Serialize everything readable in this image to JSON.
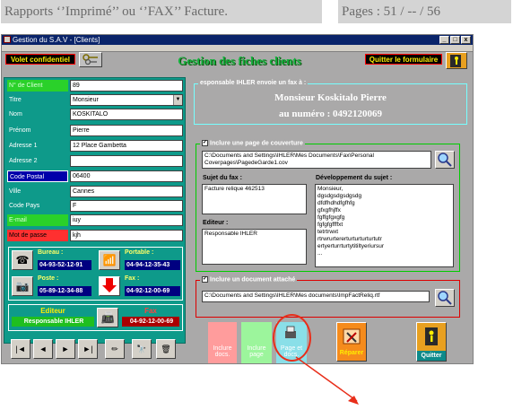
{
  "doc_header": {
    "left": "Rapports  ‘’Imprimé’’  ou  ‘’FAX’’    Facture.",
    "right": "Pages : 51 / -- / 56"
  },
  "window": {
    "title": "Gestion du S.A.V - [Clients]",
    "controls": [
      "_",
      "□",
      "x"
    ]
  },
  "top_bar": {
    "confidential_label": "Volet confidentiel",
    "main_title": "Gestion des fiches clients",
    "quit_form_label": "Quitter le formulaire"
  },
  "client_form": {
    "fields": [
      {
        "label": "N° de Client",
        "value": "89"
      },
      {
        "label": "Titre",
        "value": "Monsieur"
      },
      {
        "label": "Nom",
        "value": "KOSKITALO"
      },
      {
        "label": "Prénom",
        "value": "Pierre"
      },
      {
        "label": "Adresse 1",
        "value": "12 Place Gambetta"
      },
      {
        "label": "Adresse 2",
        "value": ""
      },
      {
        "label": "Code Postal",
        "value": "06400"
      },
      {
        "label": "Ville",
        "value": "Cannes"
      },
      {
        "label": "Code Pays",
        "value": "F"
      },
      {
        "label": "E-mail",
        "value": "iuy"
      },
      {
        "label": "Mot de passe",
        "value": "kjh"
      }
    ]
  },
  "phones": {
    "bureau_label": "Bureau :",
    "bureau_value": "04-93-52-12-91",
    "portable_label": "Portable :",
    "portable_value": "04-94-12-35-43",
    "poste_label": "Poste :",
    "poste_value": "05-89-12-34-88",
    "fax_label": "Fax :",
    "fax_value": "04-92-12-00-69"
  },
  "sender": {
    "editeur_label": "Editeur",
    "editeur_value": "Responsable IHLER",
    "fax_label": "Fax",
    "fax_value": "04-92-12-00-69"
  },
  "nav_buttons": [
    "|◄",
    "◄",
    "►",
    "►|"
  ],
  "fax_panel": {
    "caption": "esponsable IHLER envoie un fax à :",
    "recipient_name": "Monsieur Koskitalo Pierre",
    "recipient_number": "au numéro : 0492120069"
  },
  "cover_page": {
    "caption": "Inclure une page de couverture",
    "path": "C:\\Documents and Settings\\IHLER\\Mes Documents\\Fax\\Personal Coverpages\\PagedeGarde1.cov",
    "subject_label": "Sujet du fax :",
    "subject_value": "Facture relique 462513",
    "development_label": "Développement du sujet :",
    "development_lines": [
      "Monsieur,",
      "dgsdgsdgsdgsdg",
      "dfdfhdhdfgfhfg",
      "gfxgfhjffx",
      "fgffgfgxgfg",
      "fgfgfgffffxt",
      "tetrtrwxt",
      "rtrwrurtererturturturturtutr",
      "ertyerturrturtytitiltyeriursur",
      "..."
    ],
    "editor_label": "Editeur :",
    "editor_value": "Responsable IHLER"
  },
  "attachment": {
    "caption": "Inclure un document attaché",
    "path": "C:\\Documents and Settings\\IHLER\\Mes documents\\ImpFactReliq.rtf"
  },
  "action_buttons": {
    "include_docs": "Inclure docs.",
    "include_page": "Inclure page",
    "page_and_docs": "Page et docs.",
    "repair": "Réparer",
    "quit": "Quitter"
  },
  "colors": {
    "window_bg": "#aaa9a9",
    "panel_teal": "#0e9a8a",
    "title_green": "#13b13b",
    "highlight_circle": "#e82e1a"
  }
}
